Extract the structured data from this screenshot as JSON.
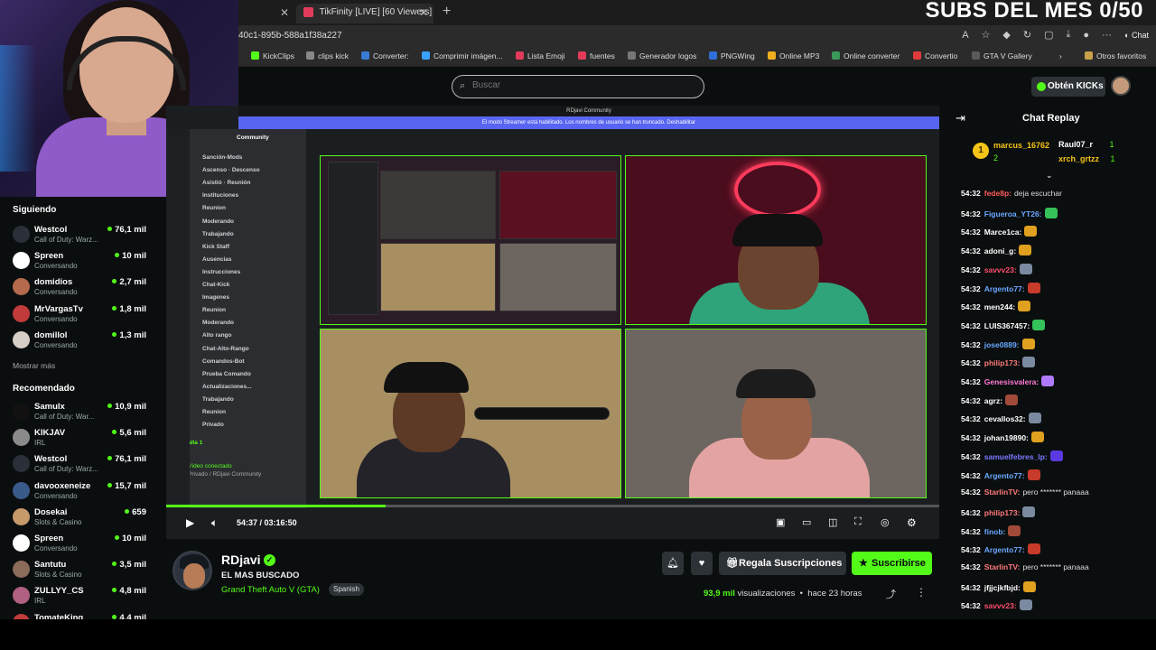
{
  "overlay": {
    "subs_text": "SUBS DEL MES 0/50"
  },
  "browser": {
    "tabs": [
      {
        "title": "ard"
      },
      {
        "title": "TikFinity [LIVE] [60 Viewers]"
      }
    ],
    "new_tab": "+",
    "url": "40c1-895b-588a1f38a227",
    "chat_button": "Chat",
    "bookmarks": [
      "KickClips",
      "clips kick",
      "Converter:",
      "Comprimir imágen...",
      "Lista Emoji",
      "fuentes",
      "Generador logos",
      "PNGWing",
      "Online MP3",
      "Online converter",
      "Convertio",
      "GTA V Gallery",
      "Otros favoritos"
    ]
  },
  "header": {
    "search_placeholder": "Buscar",
    "get_kicks": "Obtén KICKs"
  },
  "sidebar": {
    "following_title": "Siguiendo",
    "following": [
      {
        "name": "Westcol",
        "sub": "Call of Duty: Warz...",
        "viewers": "76,1 mil",
        "color": "#2a2f38"
      },
      {
        "name": "Spreen",
        "sub": "Conversando",
        "viewers": "10 mil",
        "color": "#ffffff"
      },
      {
        "name": "domidios",
        "sub": "Conversando",
        "viewers": "2,7 mil",
        "color": "#b56a4e"
      },
      {
        "name": "MrVargasTv",
        "sub": "Conversando",
        "viewers": "1,8 mil",
        "color": "#c23b3b"
      },
      {
        "name": "domillol",
        "sub": "Conversando",
        "viewers": "1,3 mil",
        "color": "#d6cfc7"
      }
    ],
    "show_more": "Mostrar más",
    "recommended_title": "Recomendado",
    "recommended": [
      {
        "name": "Samulx",
        "sub": "Call of Duty: War...",
        "viewers": "10,9 mil",
        "color": "#111111"
      },
      {
        "name": "KIKJAV",
        "sub": "IRL",
        "viewers": "5,6 mil",
        "color": "#8a8a8a"
      },
      {
        "name": "Westcol",
        "sub": "Call of Duty: Warz...",
        "viewers": "76,1 mil",
        "color": "#2a2f38"
      },
      {
        "name": "davooxeneize",
        "sub": "Conversando",
        "viewers": "15,7 mil",
        "color": "#3a5a8a"
      },
      {
        "name": "Dosekai",
        "sub": "Slots & Casino",
        "viewers": "659",
        "color": "#c69a6a"
      },
      {
        "name": "Spreen",
        "sub": "Conversando",
        "viewers": "10 mil",
        "color": "#ffffff"
      },
      {
        "name": "Santutu",
        "sub": "Slots & Casino",
        "viewers": "3,5 mil",
        "color": "#8b6b5a"
      },
      {
        "name": "ZULLYY_CS",
        "sub": "IRL",
        "viewers": "4,8 mil",
        "color": "#b06080"
      },
      {
        "name": "TomateKing",
        "sub": "",
        "viewers": "4,4 mil",
        "color": "#c23b3b"
      }
    ]
  },
  "video": {
    "window_title": "RDjavi Community",
    "banner": "El modo Streamer está habilitado. Los nombres de usuario se han truncado.   Deshabilitar",
    "server_name": "Community",
    "channels": [
      "Sanción-Mods",
      "Ascenso · Descenso",
      "Asistió · Reunión",
      "Instituciones",
      "Reunion",
      "Moderando",
      "Trabajando",
      "Kick Staff",
      "Ausencias",
      "Instrucciones",
      "Chat-Kick",
      "Imagenes",
      "Reunion",
      "Moderando",
      "Alto rango",
      "Chat-Alto-Rango",
      "Comandos-Bot",
      "Prueba Comando",
      "Actualizaciones...",
      "Trabajando",
      "Reunion",
      "Privado"
    ],
    "voice_panel": "Pantalla 1",
    "voice_connected": "Vídeo conectado",
    "voice_channel": "Privado / RDjavi Community",
    "progress": 0.284,
    "time_current": "54:37",
    "time_total": "03:16:50"
  },
  "channel": {
    "name": "RDjavi",
    "title": "EL MAS BUSCADO",
    "category": "Grand Theft Auto V (GTA)",
    "language": "Spanish",
    "gift_label": "Regala Suscripciones",
    "subscribe_label": "Suscribirse",
    "views_count": "93,9 mil",
    "views_label": "visualizaciones",
    "time_ago": "hace 23 horas"
  },
  "chat": {
    "title": "Chat Replay",
    "leaders": [
      {
        "name": "marcus_16762",
        "count": "2"
      },
      {
        "name": "Raul07_r",
        "count": "1"
      },
      {
        "name": "xrch_grtzz",
        "count": "1"
      }
    ],
    "messages": [
      {
        "time": "54:32",
        "user": "fede8p:",
        "color": "#ff5c5c",
        "text": "deja escuchar",
        "emote": ""
      },
      {
        "time": "54:32",
        "user": "Figueroa_YT26:",
        "color": "#6aa8ff",
        "text": "",
        "emote": "#35c25a"
      },
      {
        "time": "54:32",
        "user": "Marce1ca:",
        "color": "#ffffff",
        "text": "",
        "emote": "#e0a020"
      },
      {
        "time": "54:32",
        "user": "adoni_g:",
        "color": "#ffffff",
        "text": "",
        "emote": "#e0a020"
      },
      {
        "time": "54:32",
        "user": "savvv23:",
        "color": "#ff4d6d",
        "text": "",
        "emote": "#7a8aa0"
      },
      {
        "time": "54:32",
        "user": "Argento77:",
        "color": "#6aa8ff",
        "text": "",
        "emote": "#c83a2a"
      },
      {
        "time": "54:32",
        "user": "men244:",
        "color": "#ffffff",
        "text": "",
        "emote": "#e0a020"
      },
      {
        "time": "54:32",
        "user": "LUIS367457:",
        "color": "#ffffff",
        "text": "",
        "emote": "#35c25a"
      },
      {
        "time": "54:32",
        "user": "jose0889:",
        "color": "#6aa8ff",
        "text": "",
        "emote": "#e0a020"
      },
      {
        "time": "54:32",
        "user": "philip173:",
        "color": "#ff7a7a",
        "text": "",
        "emote": "#7a8aa0"
      },
      {
        "time": "54:32",
        "user": "Genesisvalera:",
        "color": "#ff7ad9",
        "text": "",
        "emote": "#b07aff"
      },
      {
        "time": "54:32",
        "user": "agrz:",
        "color": "#ffffff",
        "text": "",
        "emote": "#a04a3a"
      },
      {
        "time": "54:32",
        "user": "cevallos32:",
        "color": "#ffffff",
        "text": "",
        "emote": "#7a8aa0"
      },
      {
        "time": "54:32",
        "user": "johan19890:",
        "color": "#ffffff",
        "text": "",
        "emote": "#e0a020"
      },
      {
        "time": "54:32",
        "user": "samuelfebres_lp:",
        "color": "#7a7aff",
        "text": "",
        "emote": "#5a3ae0"
      },
      {
        "time": "54:32",
        "user": "Argento77:",
        "color": "#6aa8ff",
        "text": "",
        "emote": "#c83a2a"
      },
      {
        "time": "54:32",
        "user": "StarlinTV:",
        "color": "#ff7a7a",
        "text": "pero ******* panaaa",
        "emote": ""
      },
      {
        "time": "54:32",
        "user": "philip173:",
        "color": "#ff7a7a",
        "text": "",
        "emote": "#7a8aa0"
      },
      {
        "time": "54:32",
        "user": "finob:",
        "color": "#6aa8ff",
        "text": "",
        "emote": "#a04a3a"
      },
      {
        "time": "54:32",
        "user": "Argento77:",
        "color": "#6aa8ff",
        "text": "",
        "emote": "#c83a2a"
      },
      {
        "time": "54:32",
        "user": "StarlinTV:",
        "color": "#ff7a7a",
        "text": "pero ******* panaaa",
        "emote": ""
      },
      {
        "time": "54:32",
        "user": "jfjjcjkfbjd:",
        "color": "#ffffff",
        "text": "",
        "emote": "#e0a020"
      },
      {
        "time": "54:32",
        "user": "savvv23:",
        "color": "#ff4d6d",
        "text": "",
        "emote": "#7a8aa0"
      }
    ]
  },
  "colors": {
    "accent": "#53fc18",
    "background": "#0b0e0f",
    "gold": "#f5c518"
  }
}
